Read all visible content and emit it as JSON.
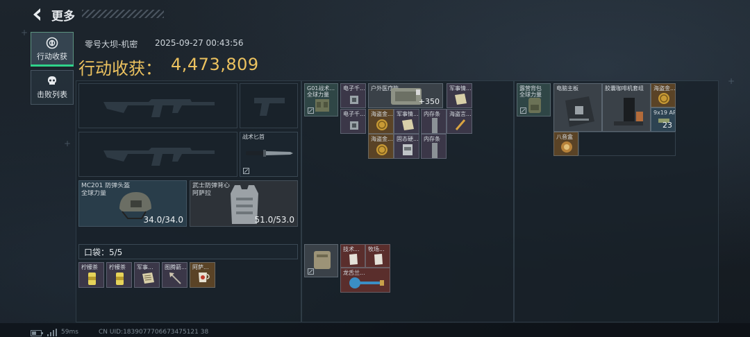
{
  "header": {
    "title": "更多"
  },
  "nav": {
    "tabs": [
      {
        "label": "行动收获",
        "icon": "loot-icon",
        "active": true
      },
      {
        "label": "击败列表",
        "icon": "skull-icon",
        "active": false
      }
    ]
  },
  "summary": {
    "map_name": "零号大坝-机密",
    "timestamp": "2025-09-27 00:43:56",
    "haul_label": "行动收获：",
    "haul_value": "4,473,809"
  },
  "equipment": {
    "knife_label": "战术匕首",
    "helmet": {
      "name": "MC201 防弹头盔",
      "brand": "全球力量",
      "durability": "34.0/34.0"
    },
    "armor": {
      "name": "武士防弹背心",
      "brand": "阿萨拉",
      "durability": "51.0/53.0"
    }
  },
  "pockets": {
    "label": "口袋：5/5",
    "items": [
      {
        "label": "柠檬茶",
        "tier": "purple",
        "icon": "can-icon"
      },
      {
        "label": "柠檬茶",
        "tier": "purple",
        "icon": "can-icon"
      },
      {
        "label": "军事...",
        "tier": "purple",
        "icon": "document-icon"
      },
      {
        "label": "图腾箭...",
        "tier": "purple",
        "icon": "arrow-icon"
      },
      {
        "label": "阿萨...",
        "tier": "gold",
        "icon": "cup-icon"
      }
    ]
  },
  "rig": {
    "label": "G01战术...",
    "sublabel": "全球力量",
    "items": [
      {
        "label": "电子千...",
        "tier": "purple"
      },
      {
        "label": "户外医疗箱",
        "tier": "grey",
        "count": "+350"
      },
      {
        "label": "军事情...",
        "tier": "purple"
      },
      {
        "label": "电子千...",
        "tier": "purple"
      },
      {
        "label": "海盗金...",
        "tier": "gold"
      },
      {
        "label": "军事情...",
        "tier": "purple"
      },
      {
        "label": "内存条",
        "tier": "purple"
      },
      {
        "label": "海盗言...",
        "tier": "purple"
      },
      {
        "label": "海盗金...",
        "tier": "gold"
      },
      {
        "label": "固态硬...",
        "tier": "purple"
      },
      {
        "label": "内存条",
        "tier": "purple"
      }
    ]
  },
  "case": {
    "items": [
      {
        "label": "技术...",
        "tier": "red"
      },
      {
        "label": "牧场...",
        "tier": "red"
      },
      {
        "label": "龙舌兰...",
        "tier": "red"
      }
    ]
  },
  "backpack": {
    "label": "露营背包",
    "sublabel": "全球力量",
    "items": [
      {
        "label": "电脑主板",
        "tier": "grey"
      },
      {
        "label": "胶囊咖啡机套组",
        "tier": "grey"
      },
      {
        "label": "海盗金...",
        "tier": "gold"
      },
      {
        "label": "9x19 AP6.3",
        "tier": "blue",
        "count": "23"
      },
      {
        "label": "八音盒",
        "tier": "gold"
      }
    ]
  },
  "footer": {
    "ping": "59ms",
    "uid": "CN UID:1839077706673475121 38"
  },
  "colors": {
    "accent_green": "#2fd38a",
    "haul_gold": "#ecc25f"
  }
}
